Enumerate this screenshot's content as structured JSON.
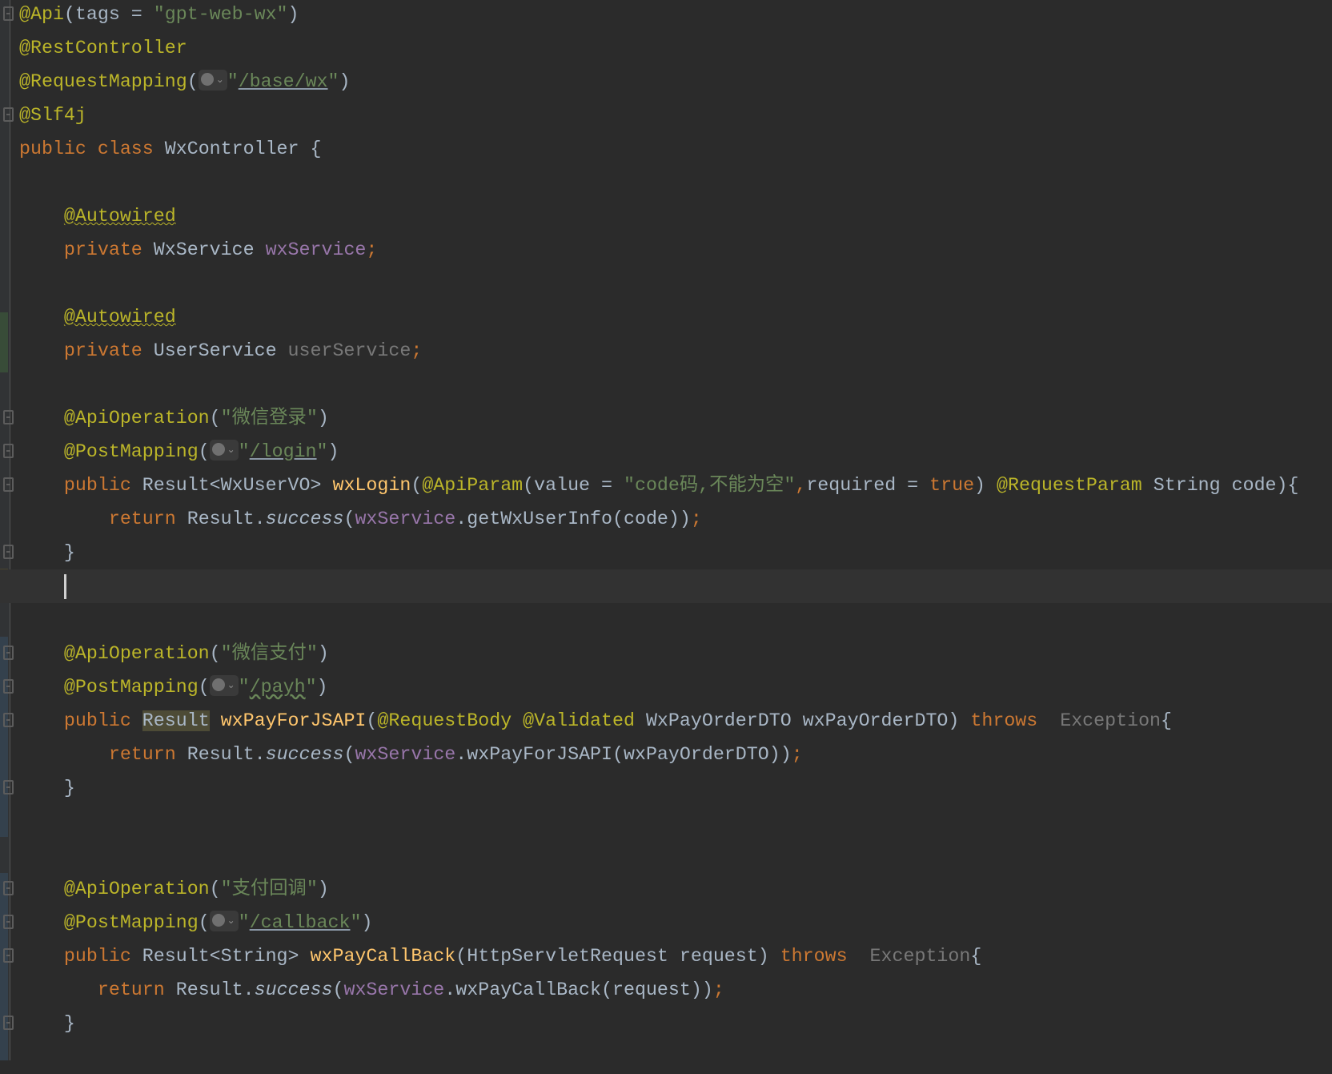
{
  "editor": {
    "colors": {
      "background": "#2b2b2b",
      "keyword": "#cc7832",
      "annotation": "#bbb529",
      "string": "#6a8759",
      "field": "#9876aa",
      "default": "#a9b7c6",
      "method": "#ffc66d",
      "unused": "#787878"
    },
    "inlay_icon": "globe-icon",
    "current_line": 17,
    "lines": [
      [
        [
          "@Api",
          "ann"
        ],
        [
          "(tags = ",
          "def"
        ],
        [
          "\"gpt-web-wx\"",
          "str"
        ],
        [
          ")",
          "def"
        ]
      ],
      [
        [
          "@RestController",
          "ann"
        ]
      ],
      [
        [
          "@RequestMapping",
          "ann"
        ],
        [
          "(",
          "def"
        ],
        [
          "",
          "inlay"
        ],
        [
          "\"",
          "str"
        ],
        [
          "/base/wx",
          "url"
        ],
        [
          "\"",
          "str"
        ],
        [
          ")",
          "def"
        ]
      ],
      [
        [
          "@Slf4j",
          "ann"
        ]
      ],
      [
        [
          "public class ",
          "kw"
        ],
        [
          "WxController {",
          "def"
        ]
      ],
      [],
      [
        [
          "    ",
          "def"
        ],
        [
          "@Autowired",
          "wavy-ann"
        ]
      ],
      [
        [
          "    private ",
          "kw"
        ],
        [
          "WxService ",
          "def"
        ],
        [
          "wxService",
          "fld"
        ],
        [
          ";",
          "kw"
        ]
      ],
      [],
      [
        [
          "    ",
          "def"
        ],
        [
          "@Autowired",
          "wavy-ann"
        ]
      ],
      [
        [
          "    private ",
          "kw"
        ],
        [
          "UserService ",
          "def"
        ],
        [
          "userService",
          "gray"
        ],
        [
          ";",
          "kw"
        ]
      ],
      [],
      [
        [
          "    ",
          "def"
        ],
        [
          "@ApiOperation",
          "ann"
        ],
        [
          "(",
          "def"
        ],
        [
          "\"微信登录\"",
          "str"
        ],
        [
          ")",
          "def"
        ]
      ],
      [
        [
          "    ",
          "def"
        ],
        [
          "@PostMapping",
          "ann"
        ],
        [
          "(",
          "def"
        ],
        [
          "",
          "inlay"
        ],
        [
          "\"",
          "str"
        ],
        [
          "/login",
          "url"
        ],
        [
          "\"",
          "str"
        ],
        [
          ")",
          "def"
        ]
      ],
      [
        [
          "    public ",
          "kw"
        ],
        [
          "Result<WxUserVO> ",
          "def"
        ],
        [
          "wxLogin",
          "mth"
        ],
        [
          "(",
          "def"
        ],
        [
          "@ApiParam",
          "ann"
        ],
        [
          "(value = ",
          "def"
        ],
        [
          "\"code码,不能为空\"",
          "str"
        ],
        [
          ",",
          "kw"
        ],
        [
          "required = ",
          "def"
        ],
        [
          "true",
          "kw"
        ],
        [
          ") ",
          "def"
        ],
        [
          "@RequestParam ",
          "ann"
        ],
        [
          "String code){",
          "def"
        ]
      ],
      [
        [
          "        return ",
          "kw"
        ],
        [
          "Result.",
          "def"
        ],
        [
          "success",
          "ital"
        ],
        [
          "(",
          "def"
        ],
        [
          "wxService",
          "fld"
        ],
        [
          ".getWxUserInfo(code))",
          "def"
        ],
        [
          ";",
          "kw"
        ]
      ],
      [
        [
          "    }",
          "def"
        ]
      ],
      [],
      [],
      [
        [
          "    ",
          "def"
        ],
        [
          "@ApiOperation",
          "ann"
        ],
        [
          "(",
          "def"
        ],
        [
          "\"微信支付\"",
          "str"
        ],
        [
          ")",
          "def"
        ]
      ],
      [
        [
          "    ",
          "def"
        ],
        [
          "@PostMapping",
          "ann"
        ],
        [
          "(",
          "def"
        ],
        [
          "",
          "inlay"
        ],
        [
          "\"",
          "str"
        ],
        [
          "/payh",
          "wavy-str"
        ],
        [
          "\"",
          "str"
        ],
        [
          ")",
          "def"
        ]
      ],
      [
        [
          "    public ",
          "kw"
        ],
        [
          "Result",
          "hl"
        ],
        [
          " ",
          "def"
        ],
        [
          "wxPayForJSAPI",
          "mth"
        ],
        [
          "(",
          "def"
        ],
        [
          "@RequestBody @Validated ",
          "ann"
        ],
        [
          "WxPayOrderDTO wxPayOrderDTO) ",
          "def"
        ],
        [
          "throws  ",
          "kw"
        ],
        [
          "Exception",
          "gray"
        ],
        [
          "{",
          "def"
        ]
      ],
      [
        [
          "        return ",
          "kw"
        ],
        [
          "Result.",
          "def"
        ],
        [
          "success",
          "ital"
        ],
        [
          "(",
          "def"
        ],
        [
          "wxService",
          "fld"
        ],
        [
          ".wxPayForJSAPI(wxPayOrderDTO))",
          "def"
        ],
        [
          ";",
          "kw"
        ]
      ],
      [
        [
          "    }",
          "def"
        ]
      ],
      [],
      [],
      [
        [
          "    ",
          "def"
        ],
        [
          "@ApiOperation",
          "ann"
        ],
        [
          "(",
          "def"
        ],
        [
          "\"支付回调\"",
          "str"
        ],
        [
          ")",
          "def"
        ]
      ],
      [
        [
          "    ",
          "def"
        ],
        [
          "@PostMapping",
          "ann"
        ],
        [
          "(",
          "def"
        ],
        [
          "",
          "inlay"
        ],
        [
          "\"",
          "str"
        ],
        [
          "/callback",
          "url"
        ],
        [
          "\"",
          "str"
        ],
        [
          ")",
          "def"
        ]
      ],
      [
        [
          "    public ",
          "kw"
        ],
        [
          "Result<String> ",
          "def"
        ],
        [
          "wxPayCallBack",
          "mth"
        ],
        [
          "(HttpServletRequest request) ",
          "def"
        ],
        [
          "throws  ",
          "kw"
        ],
        [
          "Exception",
          "gray"
        ],
        [
          "{",
          "def"
        ]
      ],
      [
        [
          "       return ",
          "kw"
        ],
        [
          "Result.",
          "def"
        ],
        [
          "success",
          "ital"
        ],
        [
          "(",
          "def"
        ],
        [
          "wxService",
          "fld"
        ],
        [
          ".wxPayCallBack(request))",
          "def"
        ],
        [
          ";",
          "kw"
        ]
      ],
      [
        [
          "    }",
          "def"
        ]
      ],
      []
    ],
    "fold_lines": [
      0,
      3,
      12,
      13,
      14,
      16,
      19,
      20,
      21,
      23,
      26,
      27,
      28,
      30
    ]
  }
}
